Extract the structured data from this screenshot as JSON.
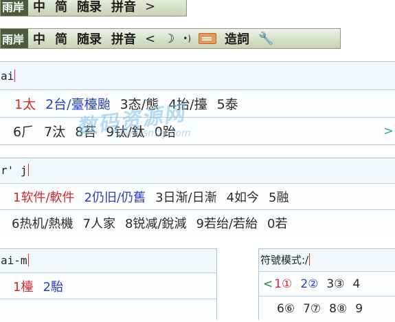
{
  "toolbar1": {
    "logo": "雨岸",
    "buttons": [
      "中",
      "简",
      "随录",
      "拼音"
    ],
    "arrow": ">"
  },
  "toolbar2": {
    "logo": "雨岸",
    "buttons": [
      "中",
      "简",
      "随录",
      "拼音"
    ],
    "prev": "<",
    "moon": "☽",
    "dots": "•)",
    "keyboard_icon": "keyboard-icon",
    "make_word": "造詞",
    "wrench": "🔧"
  },
  "panel1": {
    "composition": "ai",
    "row1": [
      {
        "label": "1太",
        "color": "red"
      },
      {
        "label": "2台/臺檯颱",
        "color": "blue"
      },
      {
        "label": "3态/態",
        "color": "dark"
      },
      {
        "label": "4抬/擡",
        "color": "dark"
      },
      {
        "label": "5泰",
        "color": "dark"
      }
    ],
    "row2": [
      {
        "label": "6⺁",
        "color": "dark"
      },
      {
        "label": "7汰",
        "color": "dark"
      },
      {
        "label": "8苔",
        "color": "dark"
      },
      {
        "label": "9钛/鈦",
        "color": "dark"
      },
      {
        "label": "0跆",
        "color": "dark"
      }
    ],
    "next": ">"
  },
  "panel2": {
    "composition": "r' j",
    "row1": [
      {
        "label": "1软件/軟件",
        "color": "red"
      },
      {
        "label": "2仍旧/仍舊",
        "color": "blue"
      },
      {
        "label": "3日渐/日漸",
        "color": "dark"
      },
      {
        "label": "4如今",
        "color": "dark"
      },
      {
        "label": "5融",
        "color": "dark"
      }
    ],
    "row2": [
      {
        "label": "6热机/熱機",
        "color": "dark"
      },
      {
        "label": "7人家",
        "color": "dark"
      },
      {
        "label": "8锐减/銳減",
        "color": "dark"
      },
      {
        "label": "9若绐/若紿",
        "color": "dark"
      },
      {
        "label": "0若",
        "color": "dark"
      }
    ]
  },
  "panel3": {
    "composition": "ai-m",
    "row1": [
      {
        "label": "1檯",
        "color": "red"
      },
      {
        "label": "2駘",
        "color": "blue"
      }
    ]
  },
  "panel4": {
    "composition": "符號模式:/",
    "prev": "<",
    "row1": [
      {
        "label": "1①",
        "color": "red"
      },
      {
        "label": "2②",
        "color": "blue"
      },
      {
        "label": "3③",
        "color": "dark"
      },
      {
        "label": "4",
        "color": "dark"
      }
    ],
    "row2": [
      {
        "label": "6⑥",
        "color": "dark"
      },
      {
        "label": "7⑦",
        "color": "dark"
      },
      {
        "label": "8⑧",
        "color": "dark"
      },
      {
        "label": "9",
        "color": "dark"
      }
    ]
  },
  "watermark": {
    "main": "数码资源网",
    "sub": "www.smzy.com"
  }
}
